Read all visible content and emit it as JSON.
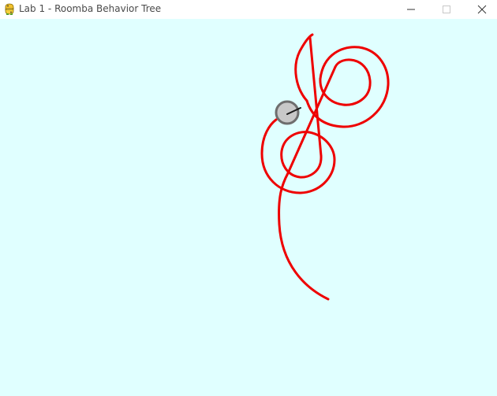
{
  "window": {
    "title": "Lab 1 - Roomba Behavior Tree",
    "app_icon": "python-icon",
    "controls": {
      "minimize": "minimize-icon",
      "maximize": "maximize-icon",
      "close": "close-icon"
    }
  },
  "simulation": {
    "background_color": "#e0ffff",
    "path_color": "#ee0000",
    "robot_body_color": "#c8c8c8",
    "robot_outline_color": "#6e6e6e",
    "robot_heading_color": "#1a1a1a"
  }
}
